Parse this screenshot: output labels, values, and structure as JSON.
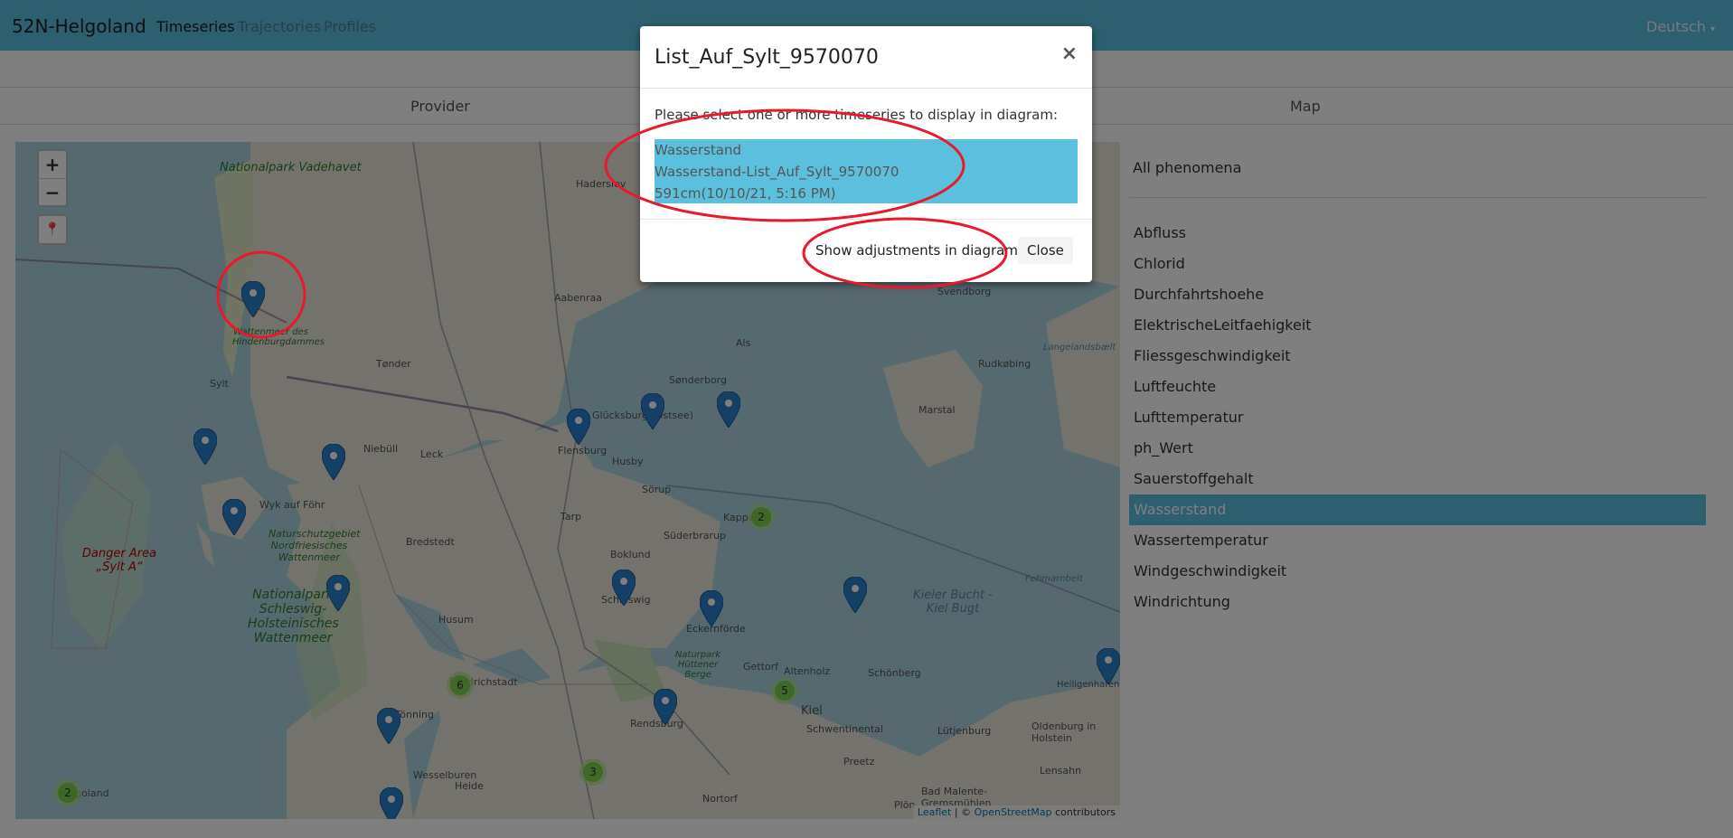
{
  "navbar": {
    "brand": "52N-Helgoland",
    "items": [
      "Timeseries",
      "Trajectories",
      "Profiles"
    ],
    "language": "Deutsch",
    "bg_color": "#5bc0de"
  },
  "tabs": [
    "Provider",
    "Map"
  ],
  "map": {
    "zoom_in": "+",
    "zoom_out": "−",
    "locate_icon": "map-marker-icon",
    "attribution": {
      "leaflet": "Leaflet",
      "sep": " | © ",
      "osm": "OpenStreetMap",
      "suffix": " contributors"
    },
    "places": [
      "Nationalpark Vadehavet",
      "Haderslev",
      "Aabenraa",
      "Svendborg",
      "Tønder",
      "Als",
      "Sønderborg",
      "Sylt",
      "Niebüll",
      "Leck",
      "Glücksburg (Ostsee)",
      "Flensburg",
      "Husby",
      "Marstal",
      "Rudkøbing",
      "Wyk auf Föhr",
      "Sörup",
      "Tarp",
      "Kappeln",
      "Bredstedt",
      "Süderbrarup",
      "Boklund",
      "Schleswig",
      "Husum",
      "Eckernförde",
      "Danger Area „Sylt A“",
      "Nationalpark Schleswig-Holsteinisches Wattenmeer",
      "Naturschutzgebiet Nordfriesisches Wattenmeer",
      "Kieler Bucht - Kiel Bugt",
      "Fehmarnbelt",
      "Gettorf",
      "Altenholz",
      "Schönberg",
      "Kiel",
      "Schwentinental",
      "Heiligenhafen",
      "Rendsburg",
      "Tönning",
      "Friedrichstadt",
      "Lütjenburg",
      "Oldenburg in Holstein",
      "Preetz",
      "Lensahn",
      "Wesselburen",
      "Heide",
      "Nortorf",
      "Bad Malente-Gremsmühlen",
      "Plön",
      "Naturpark Hüttener Berge",
      "Langelandsbælt",
      "Wattenmeer des Hindenburgdammes",
      "Helgoland"
    ],
    "clusters": [
      "2",
      "6",
      "5",
      "3",
      "2"
    ],
    "marker_color": "#2a81cb",
    "cluster_color": "#6ecc39"
  },
  "phenomena": {
    "all_label": "All phenomena",
    "items": [
      "Abfluss",
      "Chlorid",
      "Durchfahrtshoehe",
      "ElektrischeLeitfaehigkeit",
      "Fliessgeschwindigkeit",
      "Luftfeuchte",
      "Lufttemperatur",
      "ph_Wert",
      "Sauerstoffgehalt",
      "Wasserstand",
      "Wassertemperatur",
      "Windgeschwindigkeit",
      "Windrichtung"
    ],
    "selected": "Wasserstand"
  },
  "modal": {
    "title": "List_Auf_Sylt_9570070",
    "close_glyph": "×",
    "prompt": "Please select one or more timeseries to display in diagram:",
    "timeseries": {
      "phenomenon": "Wasserstand",
      "label": "Wasserstand-List_Auf_Sylt_9570070",
      "value": "591cm(10/10/21, 5:16 PM)"
    },
    "adjust_button": "Show adjustments in diagram",
    "close_button": "Close"
  },
  "annotation_color": "#e8192c"
}
